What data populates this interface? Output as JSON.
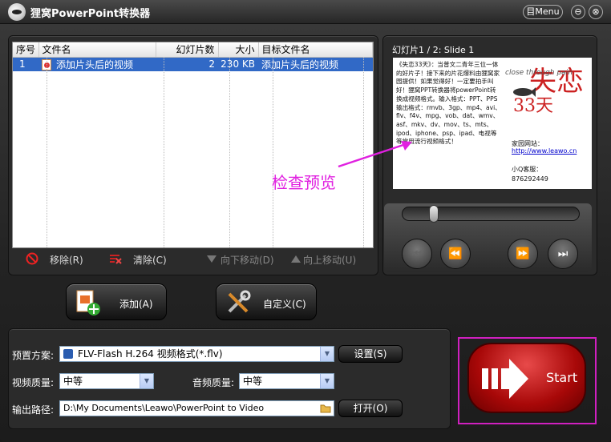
{
  "window": {
    "title": "狸窝PowerPoint转换器",
    "menu_label": "目Menu",
    "minimize": "⊖",
    "close": "⊗"
  },
  "file_table": {
    "columns": [
      "序号",
      "文件名",
      "幻灯片数",
      "大小",
      "目标文件名"
    ],
    "rows": [
      {
        "index": "1",
        "name": "添加片头后的视频",
        "slides": "2",
        "size": "230 KB",
        "target": "添加片头后的视频"
      }
    ]
  },
  "list_actions": {
    "remove": "移除(R)",
    "clear": "清除(C)",
    "move_down": "向下移动(D)",
    "move_up": "向上移动(U)"
  },
  "buttons": {
    "add": "添加(A)",
    "customize": "自定义(C)",
    "settings": "设置(S)",
    "open": "打开(O)",
    "start": "Start"
  },
  "preview": {
    "title": "幻灯片1 / 2: Slide 1",
    "slide_text": "《失恋33天》：当普文二青年三位一体的好片子！接下来的片花爆料由狸窝家园提供！如果觉得好！一定要拍手叫好！狸窝PPT转换器将powerPoint转换成视频格式。输入格式：PPT、PPS 输出格式：rmvb、3gp、mp4、avi、flv、f4v、mpg、vob、dat、wmv、asf、mkv、dv、mov、ts、mts、ipod、iphone、psp、ipad、电视等等常用流行视频格式！",
    "slide_title_big": "失恋",
    "slide_number_big": "33天",
    "slide_script": "close through pain",
    "slide_site_label": "家园网站：",
    "slide_site": "http://www.leawo.cn",
    "slide_qq_label": "小Q客服：",
    "slide_qq": "876292449",
    "annotation": "检查预览"
  },
  "settings": {
    "preset_label": "预置方案:",
    "preset_value": "FLV-Flash H.264 视频格式(*.flv)",
    "video_quality_label": "视频质量:",
    "video_quality_value": "中等",
    "audio_quality_label": "音频质量:",
    "audio_quality_value": "中等",
    "output_label": "输出路径:",
    "output_value": "D:\\My Documents\\Leawo\\PowerPoint to Video"
  },
  "colors": {
    "accent_selection": "#3169c6",
    "start_red": "#c81010",
    "annotation_magenta": "#e020e0"
  }
}
